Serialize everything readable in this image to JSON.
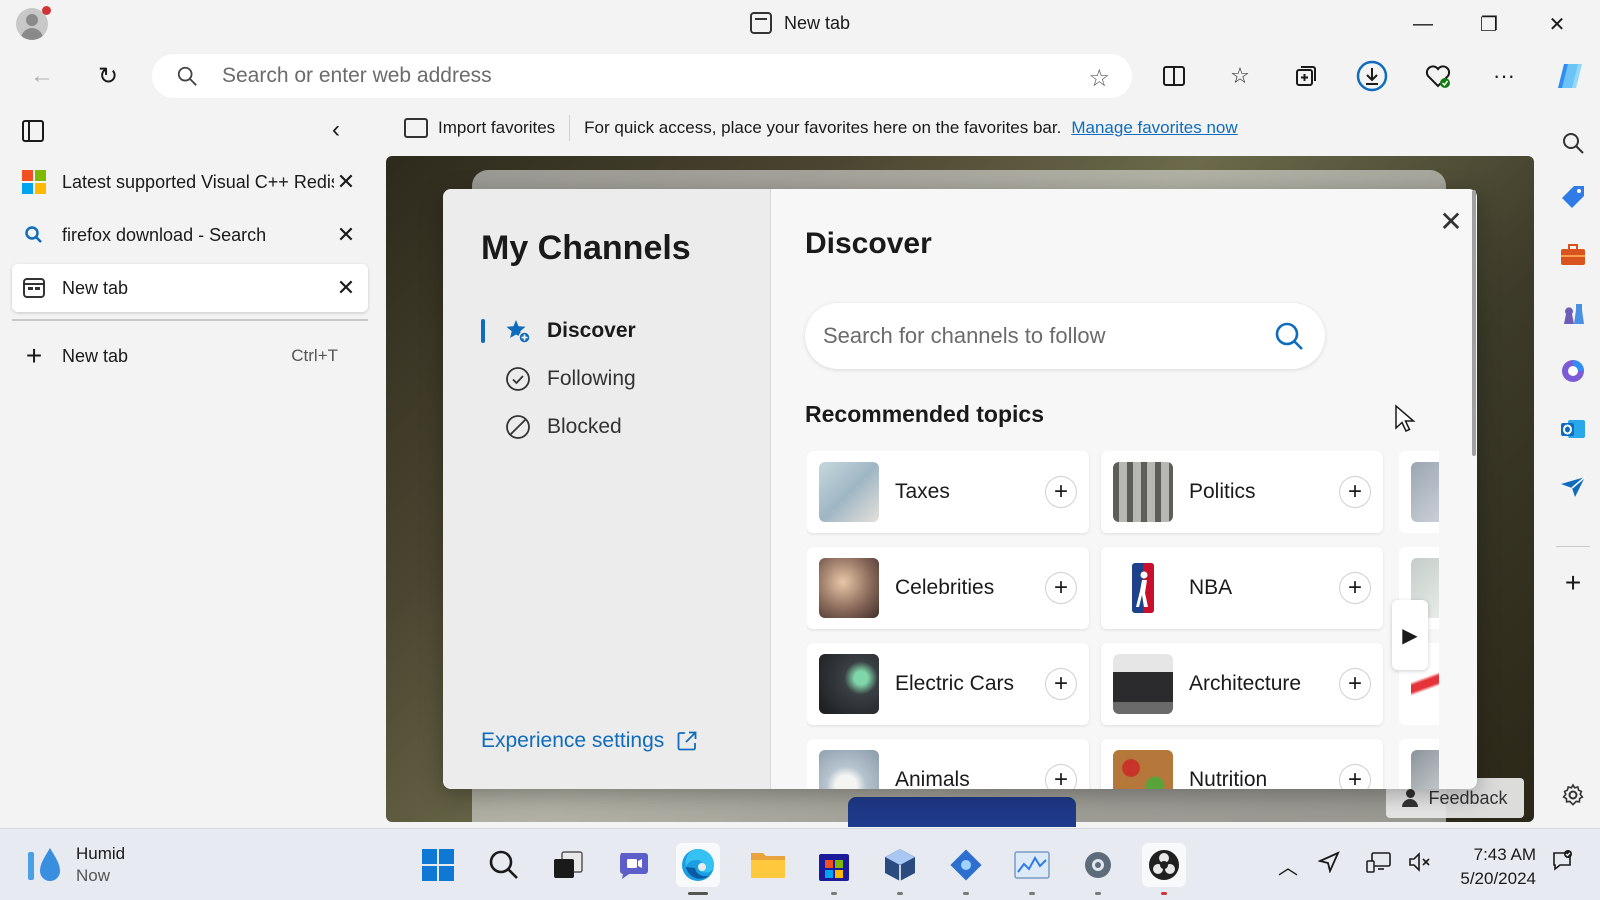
{
  "window": {
    "title": "New tab",
    "controls": [
      "minimize",
      "restore",
      "close"
    ]
  },
  "toolbar": {
    "address_placeholder": "Search or enter web address",
    "address_value": ""
  },
  "favorites_bar": {
    "import_label": "Import favorites",
    "message": "For quick access, place your favorites here on the favorites bar.",
    "manage_link": "Manage favorites now"
  },
  "vertical_tabs": {
    "tabs": [
      {
        "label": "Latest supported Visual C++ Redistributable downloads",
        "icon": "microsoft-logo",
        "active": false
      },
      {
        "label": "firefox download - Search",
        "icon": "search-icon",
        "active": false
      },
      {
        "label": "New tab",
        "icon": "new-tab-icon",
        "active": true
      }
    ],
    "new_tab_label": "New tab",
    "new_tab_shortcut": "Ctrl+T"
  },
  "dialog": {
    "title": "My Channels",
    "menu": [
      {
        "label": "Discover",
        "icon": "star-plus-icon",
        "active": true
      },
      {
        "label": "Following",
        "icon": "check-circle-icon",
        "active": false
      },
      {
        "label": "Blocked",
        "icon": "blocked-icon",
        "active": false
      }
    ],
    "experience_settings": "Experience settings",
    "section_title": "Discover",
    "search_placeholder": "Search for channels to follow",
    "recommended_title": "Recommended topics",
    "topics": [
      {
        "name": "Taxes",
        "color": "#9fb6c4"
      },
      {
        "name": "Politics",
        "color": "#8a8a86"
      },
      {
        "name": "Celebrities",
        "color": "#8a6a5a"
      },
      {
        "name": "NBA",
        "color": "#ffffff"
      },
      {
        "name": "Electric Cars",
        "color": "#3a3f44"
      },
      {
        "name": "Architecture",
        "color": "#2b2b2e"
      },
      {
        "name": "Animals",
        "color": "#b6c4cf"
      },
      {
        "name": "Nutrition",
        "color": "#b5783a"
      }
    ]
  },
  "page": {
    "feedback_label": "Feedback"
  },
  "taskbar": {
    "weather_condition": "Humid",
    "weather_time": "Now",
    "time": "7:43 AM",
    "date": "5/20/2024",
    "apps": [
      "windows-start",
      "search",
      "task-view",
      "teams",
      "edge",
      "file-explorer",
      "microsoft-store",
      "3d-viewer",
      "dev-tool",
      "performance-monitor",
      "settings",
      "obs-studio"
    ]
  },
  "colors": {
    "accent": "#0f6cbd",
    "page_bg": "#f3f3f3",
    "notification_dot": "#d13438"
  }
}
